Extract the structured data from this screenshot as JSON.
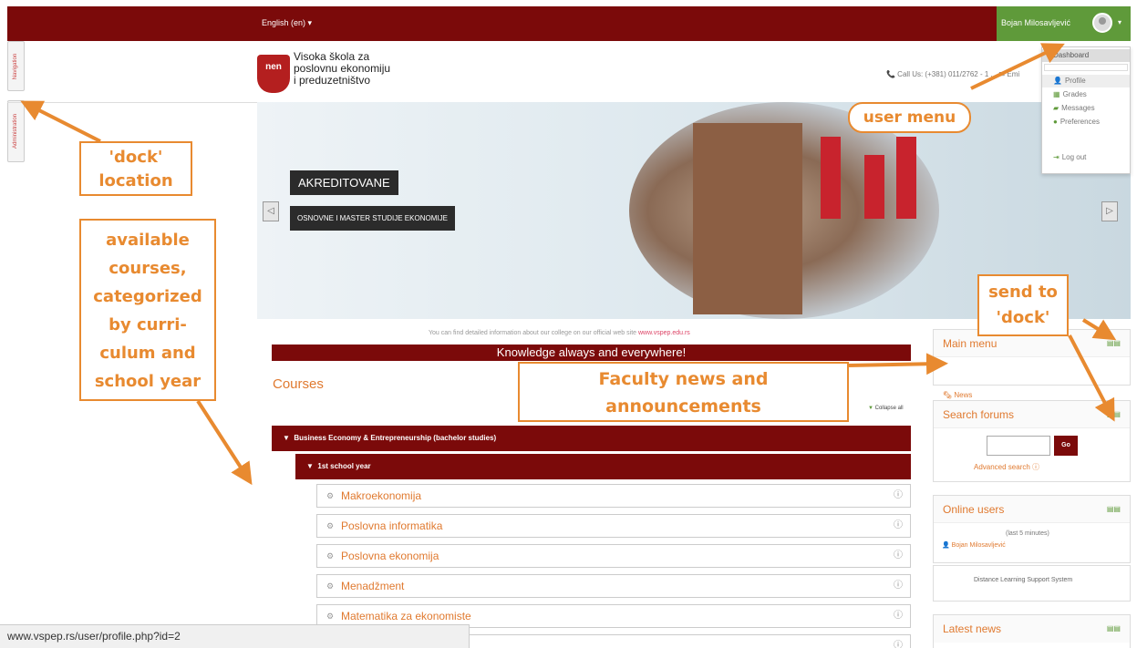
{
  "navbar": {
    "language": "English (en) ▾",
    "user_name": "Bojan Milosavljević",
    "caret": "▾"
  },
  "dock": {
    "navigation_tab": "Navigation",
    "administration_tab": "Administration"
  },
  "logo": {
    "mark": "nen",
    "line1": "Visoka škola za",
    "line2": "poslovnu ekonomiju",
    "line3": "i preduzetništvo"
  },
  "contact": "📞 Call Us: (+381) 011/2762 - 1 ...  ✉ Emi",
  "user_menu": {
    "items": [
      {
        "label": "Dashboard",
        "icon": ""
      },
      {
        "label": "Profile",
        "icon": "user-icon"
      },
      {
        "label": "Grades",
        "icon": "grades-icon"
      },
      {
        "label": "Messages",
        "icon": "messages-icon"
      },
      {
        "label": "Preferences",
        "icon": "preferences-icon"
      },
      {
        "label": "Log out",
        "icon": "logout-icon"
      }
    ]
  },
  "hero": {
    "headline": "AKREDITOVANE",
    "subline": "OSNOVNE I MASTER STUDIJE EKONOMIJE",
    "prev": "◁",
    "next": "▷"
  },
  "content": {
    "info_text": "You can find detailed information about our college on our official web site ",
    "info_link": "www.vspep.edu.rs",
    "motto": "Knowledge always and everywhere!",
    "courses_heading": "Courses",
    "collapse_all": "Collapse all",
    "category": "Business Economy & Entrepreneurship (bachelor studies)",
    "subcategory": "1st school year",
    "courses": [
      "Makroekonomija",
      "Poslovna informatika",
      "Poslovna ekonomija",
      "Menadžment",
      "Matematika za ekonomiste"
    ]
  },
  "blocks": {
    "main_menu": "Main menu",
    "news": "News",
    "search_forums": "Search forums",
    "go": "Go",
    "advanced_search": "Advanced search",
    "online_users": "Online users",
    "last_minutes": "(last 5 minutes)",
    "online_user": "Bojan Milosavljević",
    "dlss": "Distance Learning Support System",
    "latest_news": "Latest news"
  },
  "status_bar": "www.vspep.rs/user/profile.php?id=2",
  "annotations": {
    "dock_location": "'dock' location",
    "available_courses": "available courses, categorized by curri-culum and school year",
    "user_menu": "user menu",
    "send_to_dock": "send to 'dock'",
    "faculty_news": "Faculty news and announcements"
  },
  "colors": {
    "brand": "#7b0a0a",
    "accent": "#e07a30",
    "user_green": "#5f9a3a",
    "annotation": "#e88a30"
  }
}
